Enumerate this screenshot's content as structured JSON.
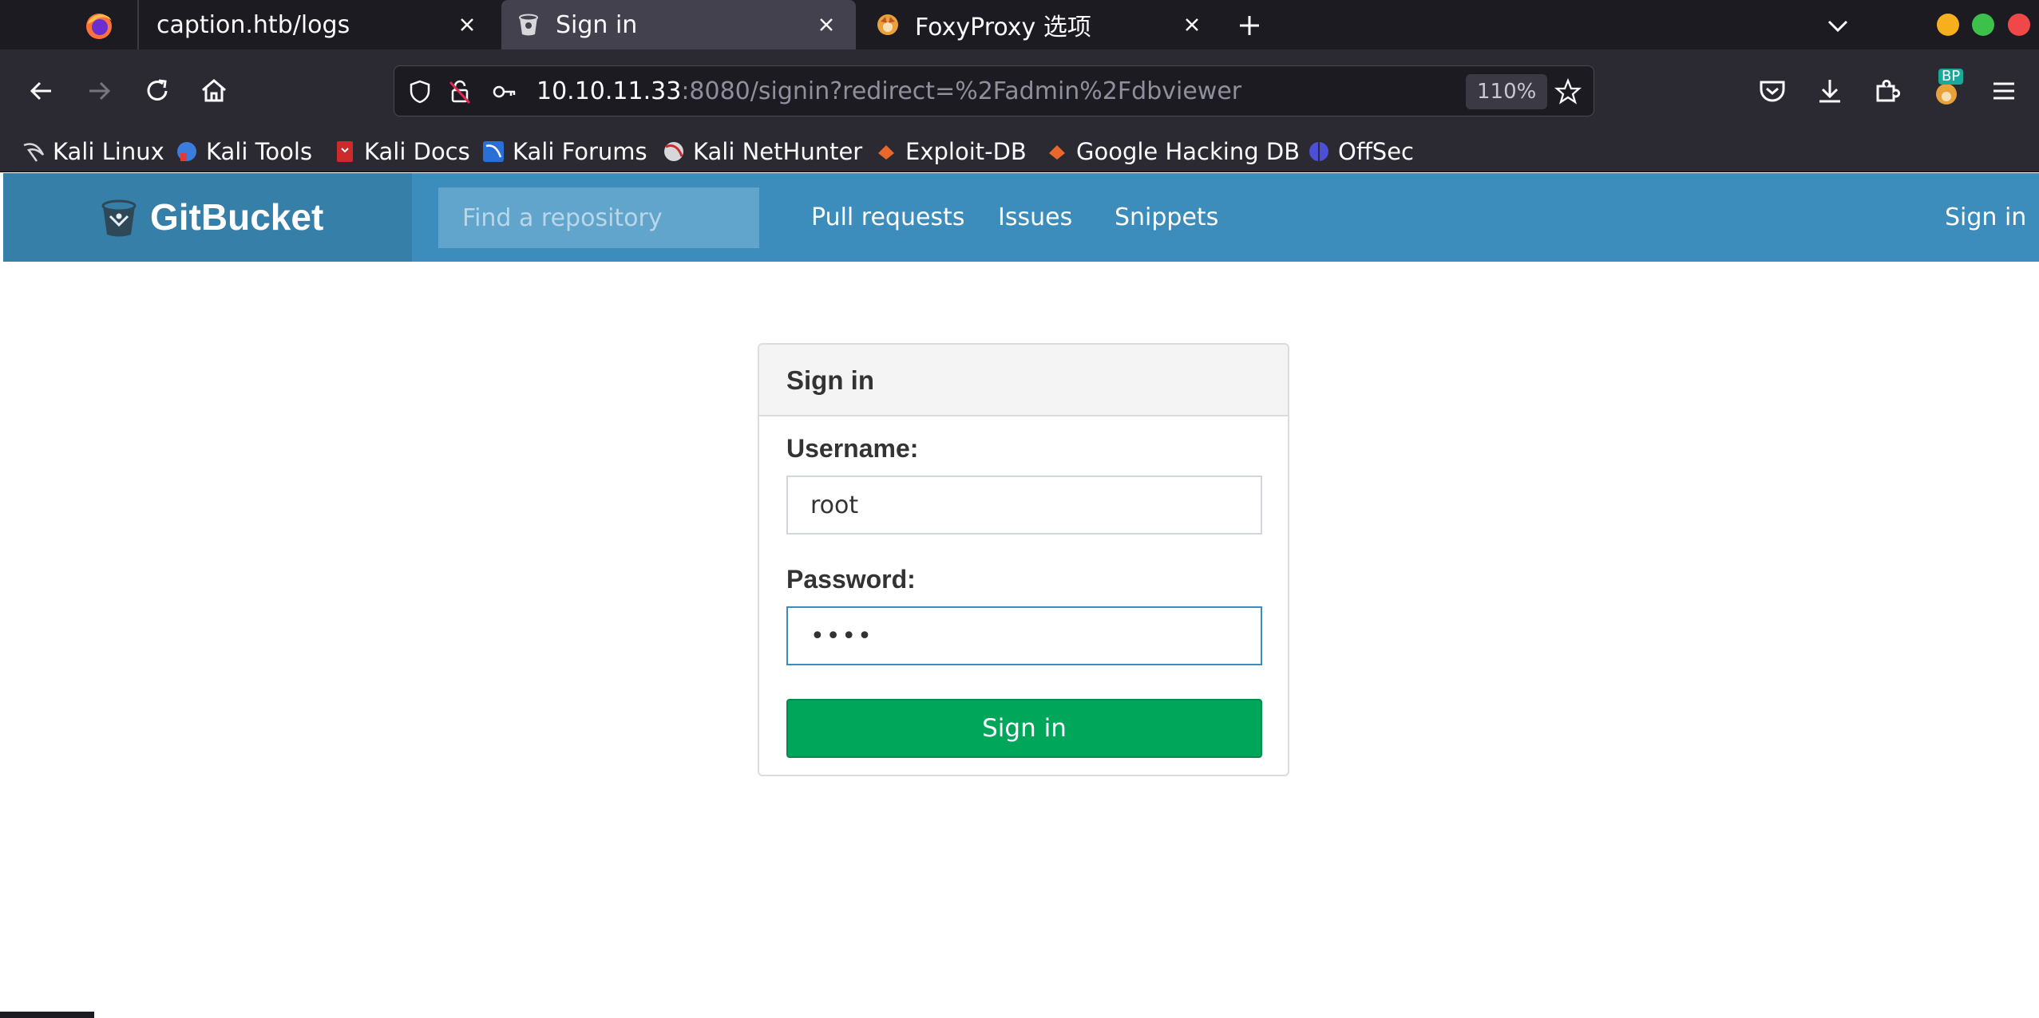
{
  "browser": {
    "tabs": [
      {
        "title": "caption.htb/logs",
        "active": false
      },
      {
        "title": "Sign in",
        "active": true
      },
      {
        "title": "FoxyProxy 选项",
        "active": false
      }
    ],
    "url_host": "10.10.11.33",
    "url_rest": ":8080/signin?redirect=%2Fadmin%2Fdbviewer",
    "zoom": "110%",
    "extension_badge": "BP",
    "bookmarks": [
      {
        "label": "Kali Linux"
      },
      {
        "label": "Kali Tools"
      },
      {
        "label": "Kali Docs"
      },
      {
        "label": "Kali Forums"
      },
      {
        "label": "Kali NetHunter"
      },
      {
        "label": "Exploit-DB"
      },
      {
        "label": "Google Hacking DB"
      },
      {
        "label": "OffSec"
      }
    ]
  },
  "header": {
    "brand": "GitBucket",
    "search_placeholder": "Find a repository",
    "nav": [
      {
        "label": "Pull requests"
      },
      {
        "label": "Issues"
      },
      {
        "label": "Snippets"
      }
    ],
    "sign_in": "Sign in"
  },
  "signin": {
    "title": "Sign in",
    "username_label": "Username:",
    "username_value": "root",
    "password_label": "Password:",
    "password_value": "root",
    "button": "Sign in"
  },
  "colors": {
    "header": "#3c8dbc",
    "brand_bg": "#367fa9",
    "button": "#00a65a",
    "focus_border": "#3c8dbc"
  }
}
